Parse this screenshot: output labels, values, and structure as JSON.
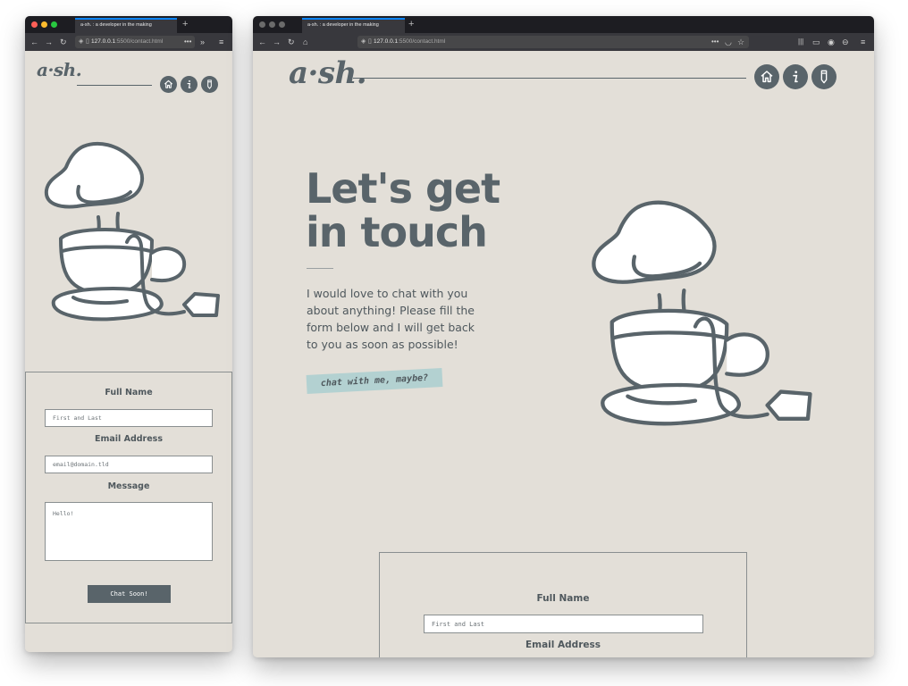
{
  "browser": {
    "tab_title": "a-sh. : a developer in the making",
    "url_host": "127.0.0.1",
    "url_path": ":5500/contact.html",
    "light_colors": [
      "#fe5f57",
      "#febc2e",
      "#28c840"
    ],
    "light_colors_inactive": [
      "#6b6b6b",
      "#6b6b6b",
      "#6b6b6b"
    ]
  },
  "site": {
    "logo": "a·sh.",
    "nav": [
      {
        "name": "home",
        "icon": "home-icon"
      },
      {
        "name": "info",
        "icon": "info-icon"
      },
      {
        "name": "contact",
        "icon": "pencil-icon"
      }
    ],
    "accent": "#59646a",
    "background": "#e3dfd8",
    "tag_color": "#b3d1d1"
  },
  "hero": {
    "headline_line1": "Let's get",
    "headline_line2": "in touch",
    "intro": "I would love to chat with you about anything! Please fill the form below and I will get back to you as soon as possible!",
    "tag": "chat with me, maybe?"
  },
  "form": {
    "name_label": "Full Name",
    "name_placeholder": "First and Last",
    "email_label": "Email Address",
    "email_placeholder": "email@domain.tld",
    "message_label": "Message",
    "message_placeholder": "Hello!",
    "submit_label": "Chat Soon!"
  }
}
